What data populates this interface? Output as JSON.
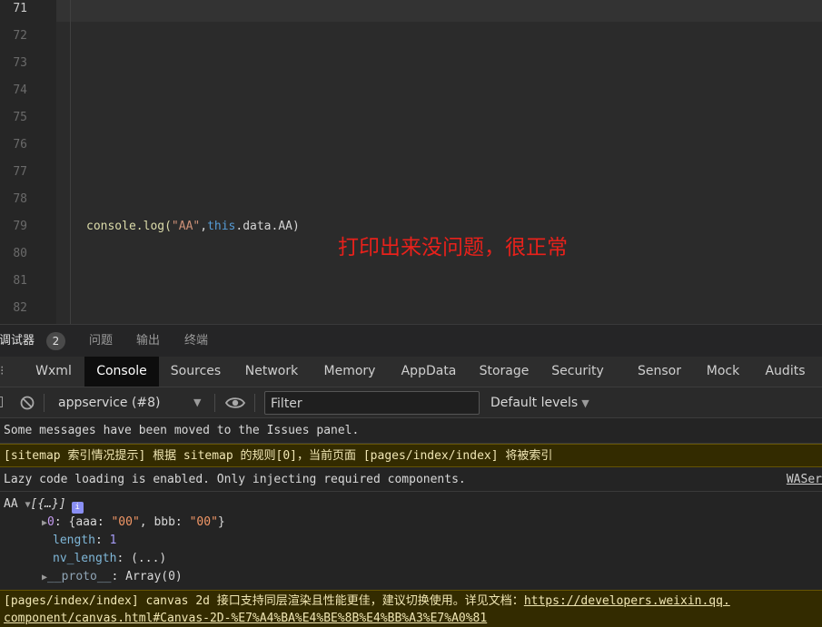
{
  "editor": {
    "line_numbers": [
      "71",
      "72",
      "73",
      "74",
      "75",
      "76",
      "77",
      "78",
      "79",
      "80",
      "81",
      "82"
    ],
    "code_line": {
      "fn": "console.log(",
      "str": "\"AA\"",
      "comma": ",",
      "kw": "this",
      "rest": ".data.AA)"
    },
    "annotation": "打印出来没问题，很正常"
  },
  "panel_tabs": {
    "debugger": "调试器",
    "badge": "2",
    "issues": "问题",
    "output": "输出",
    "terminal": "终端"
  },
  "devtools_tabs": [
    "Wxml",
    "Console",
    "Sources",
    "Network",
    "Memory",
    "AppData",
    "Storage",
    "Security",
    "Sensor",
    "Mock",
    "Audits"
  ],
  "active_devtools_tab": "Console",
  "toolbar": {
    "context": "appservice (#8)",
    "filter_placeholder": "Filter",
    "levels": "Default levels"
  },
  "console": {
    "issues_msg": "Some messages have been moved to the Issues panel.",
    "sitemap_msg": "[sitemap 索引情况提示] 根据 sitemap 的规则[0]，当前页面 [pages/index/index] 将被索引",
    "lazy_msg": "Lazy code loading is enabled. Only injecting required components.",
    "lazy_source": "WASer",
    "log": {
      "label": "AA",
      "summary": "[{…}]",
      "item0_key": "0",
      "item0_open": "{aaa: ",
      "item0_v1": "\"00\"",
      "item0_mid": ", bbb: ",
      "item0_v2": "\"00\"",
      "item0_close": "}",
      "length_key": "length",
      "length_val": "1",
      "nv_key": "nv_length",
      "nv_val": "(...)",
      "proto_key": "__proto__",
      "proto_val": "Array(0)"
    },
    "canvas_msg_prefix": "[pages/index/index] canvas 2d 接口支持同层渲染且性能更佳，建议切换使用。详见文档：",
    "canvas_link_1": "https://developers.weixin.qq.",
    "canvas_link_2": "component/canvas.html#Canvas-2D-%E7%A4%BA%E4%BE%8B%E4%BB%A3%E7%A0%81"
  }
}
